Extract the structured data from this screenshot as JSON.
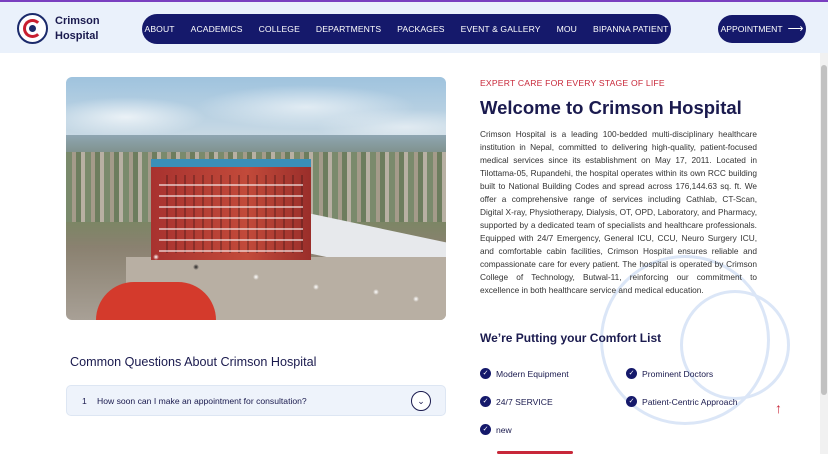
{
  "header": {
    "brand": "Crimson Hospital",
    "nav": [
      "ABOUT",
      "ACADEMICS",
      "COLLEGE",
      "DEPARTMENTS",
      "PACKAGES",
      "EVENT & GALLERY",
      "MOU",
      "BIPANNA PATIENT"
    ],
    "appointment_label": "APPOINTMENT",
    "appointment_icon": "arrow-right-icon"
  },
  "welcome": {
    "eyebrow": "EXPERT CARE FOR EVERY STAGE OF LIFE",
    "title": "Welcome to Crimson Hospital",
    "description": "Crimson Hospital is a leading 100-bedded multi-disciplinary healthcare institution in Nepal, committed to delivering high-quality, patient-focused medical services since its establishment on May 17, 2011. Located in Tilottama-05, Rupandehi, the hospital operates within its own RCC building built to National Building Codes and spread across 176,144.63 sq. ft. We offer a comprehensive range of services including Cathlab, CT-Scan, Digital X-ray, Physiotherapy, Dialysis, OT, OPD, Laboratory, and Pharmacy, supported by a dedicated team of specialists and healthcare professionals. Equipped with 24/7 Emergency, General ICU, CCU, Neuro Surgery ICU, and comfortable cabin facilities, Crimson Hospital ensures reliable and compassionate care for every patient. The hospital is operated by Crimson College of Technology, Butwal-11, reinforcing our commitment to excellence in both healthcare service and medical education."
  },
  "comfort": {
    "title": "We’re Putting your Comfort List",
    "items": [
      "Modern Equipment",
      "Prominent Doctors",
      "24/7 SERVICE",
      "Patient-Centric Approach",
      "new"
    ]
  },
  "faq": {
    "title": "Common Questions About Crimson Hospital",
    "items": [
      {
        "number": "1",
        "question": "How soon can I make an appointment for consultation?"
      }
    ]
  },
  "colors": {
    "primary": "#15196b",
    "accent": "#c8283a"
  }
}
